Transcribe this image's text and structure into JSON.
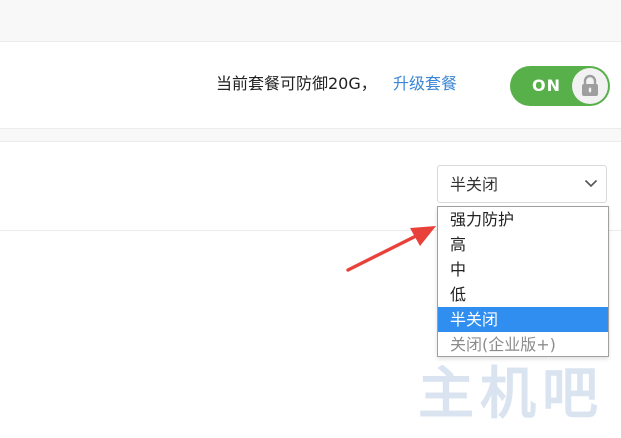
{
  "plan": {
    "description": "当前套餐可防御20G，",
    "upgrade_link": "升级套餐"
  },
  "toggle": {
    "label": "ON",
    "state": "on",
    "color": "#58b04a",
    "icon": "lock-icon"
  },
  "protection_select": {
    "current_value": "半关闭",
    "options": [
      {
        "label": "强力防护",
        "selected": false,
        "disabled": false
      },
      {
        "label": "高",
        "selected": false,
        "disabled": false
      },
      {
        "label": "中",
        "selected": false,
        "disabled": false
      },
      {
        "label": "低",
        "selected": false,
        "disabled": false
      },
      {
        "label": "半关闭",
        "selected": true,
        "disabled": false
      },
      {
        "label": "关闭(企业版+)",
        "selected": false,
        "disabled": true
      }
    ],
    "highlight_color": "#2f8ef0"
  },
  "annotation": {
    "arrow_color": "#e8413a",
    "icon": "red-arrow-annotation"
  },
  "watermark": {
    "text": "主机吧"
  },
  "colors": {
    "link": "#3b86d6",
    "page_bg": "#f8f8f9"
  }
}
